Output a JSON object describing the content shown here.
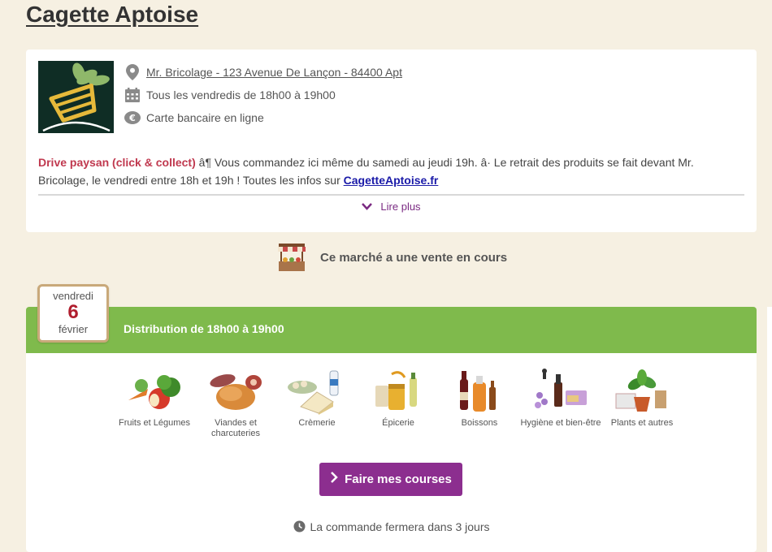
{
  "market": {
    "title": "Cagette Aptoise",
    "address": "Mr. Bricolage - 123 Avenue De Lançon - 84400 Apt",
    "schedule": "Tous les vendredis de 18h00 à 19h00",
    "payment": "Carte bancaire en ligne"
  },
  "description": {
    "drive": "Drive paysan (click & collect)",
    "text": " â¶ Vous commandez ici même du samedi au jeudi 19h. â· Le retrait des produits se fait devant Mr. Bricolage, le vendredi entre 18h et 19h ! Toutes les infos sur ",
    "link": "CagetteAptoise.fr",
    "read_more": "Lire plus"
  },
  "sale_banner": "Ce marché a une vente en cours",
  "distribution": {
    "day_name": "vendredi",
    "day_number": "6",
    "month": "février",
    "title": "Distribution de 18h00 à 19h00",
    "categories": [
      {
        "label": "Fruits et Légumes",
        "icon": "fruits-vegetables-icon"
      },
      {
        "label": "Viandes et charcuteries",
        "icon": "meat-icon"
      },
      {
        "label": "Crèmerie",
        "icon": "dairy-icon"
      },
      {
        "label": "Épicerie",
        "icon": "grocery-icon"
      },
      {
        "label": "Boissons",
        "icon": "drinks-icon"
      },
      {
        "label": "Hygiène et bien-être",
        "icon": "hygiene-icon"
      },
      {
        "label": "Plants et autres",
        "icon": "plants-icon"
      }
    ],
    "shop_button": "Faire mes courses",
    "closing_note": "La commande fermera dans 3 jours"
  },
  "colors": {
    "green_header": "#7fba4c",
    "purple_button": "#8c2e8f",
    "date_red": "#b01e2e",
    "drive_red": "#c0394f",
    "background": "#f6f0e2"
  }
}
